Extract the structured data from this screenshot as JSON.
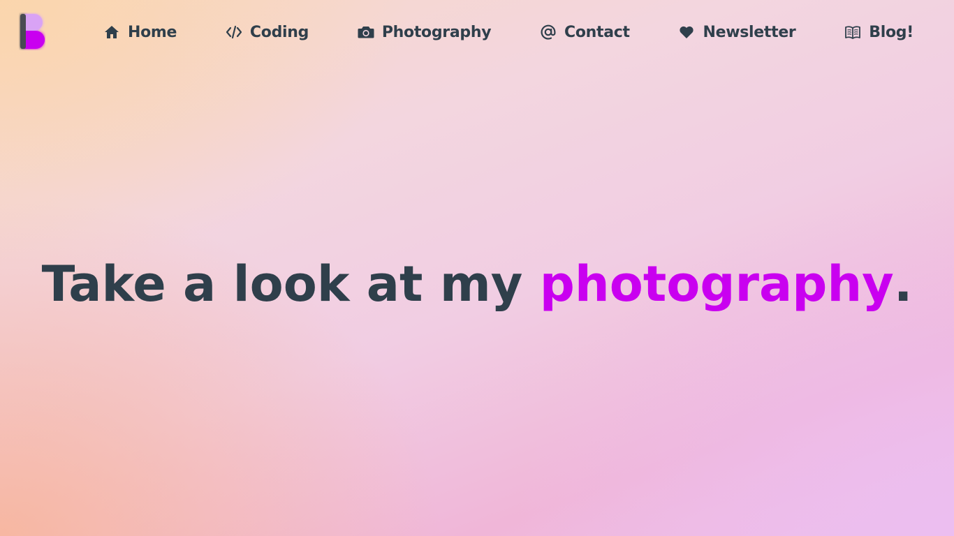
{
  "nav": {
    "items": [
      {
        "label": "Home",
        "icon": "home-icon"
      },
      {
        "label": "Coding",
        "icon": "code-icon"
      },
      {
        "label": "Photography",
        "icon": "camera-icon"
      },
      {
        "label": "Contact",
        "icon": "at-icon"
      },
      {
        "label": "Newsletter",
        "icon": "heart-icon"
      },
      {
        "label": "Blog!",
        "icon": "book-icon"
      }
    ]
  },
  "hero": {
    "prefix": "Take a look at my ",
    "highlight": "photography",
    "suffix": "."
  },
  "colors": {
    "text": "#2f3f4b",
    "accent": "#c900f0",
    "logo_light": "#d9a3f5",
    "logo_dark": "#4a4c52"
  }
}
